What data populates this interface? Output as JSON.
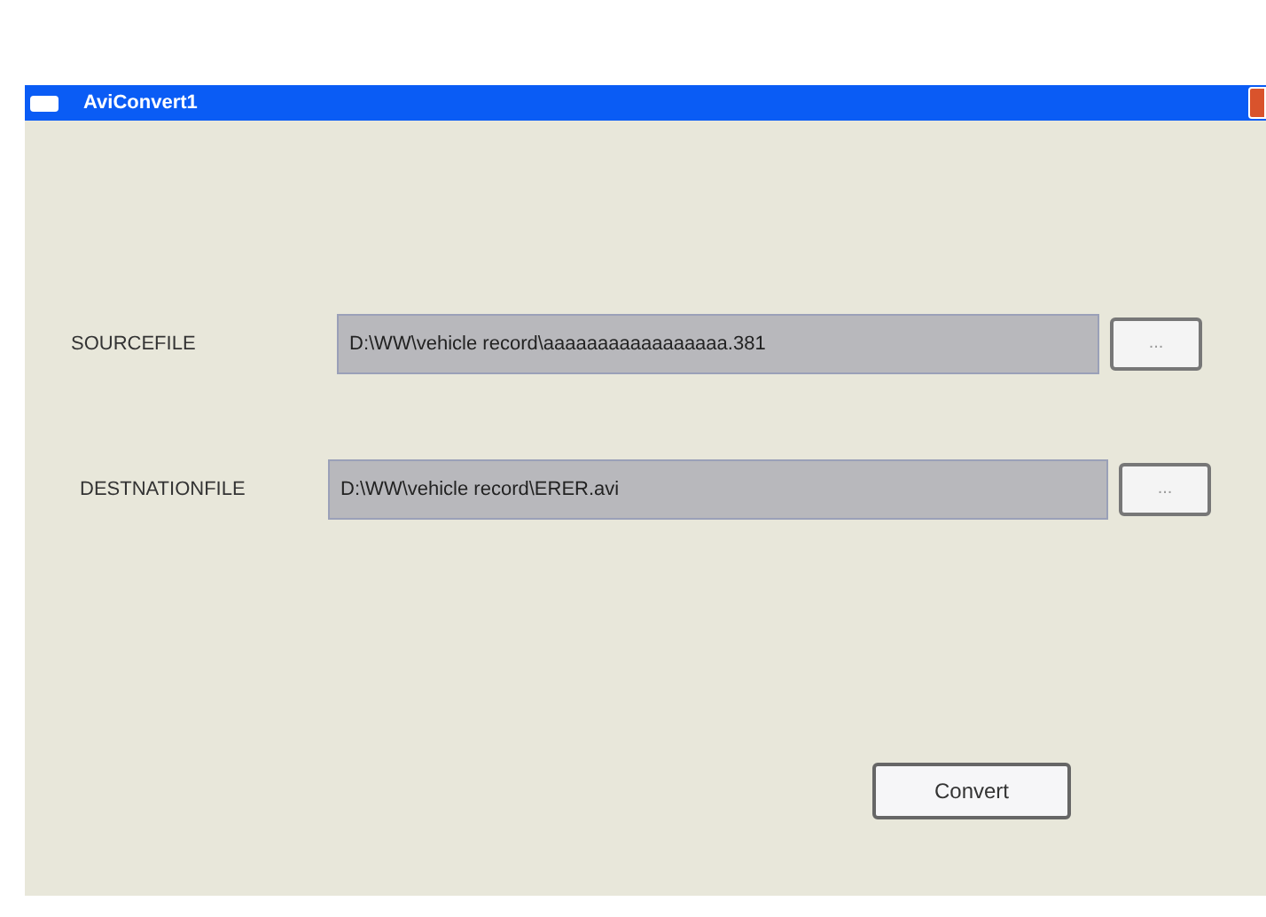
{
  "window": {
    "title": "AviConvert1"
  },
  "fields": [
    {
      "label": "SOURCEFILE",
      "value": "D:\\WW\\vehicle record\\aaaaaaaaaaaaaaaaa.381",
      "button": "..."
    },
    {
      "label": "DESTNATIONFILE",
      "value": "D:\\WW\\vehicle record\\ERER.avi",
      "button": "..."
    }
  ],
  "action_button": "Convert"
}
